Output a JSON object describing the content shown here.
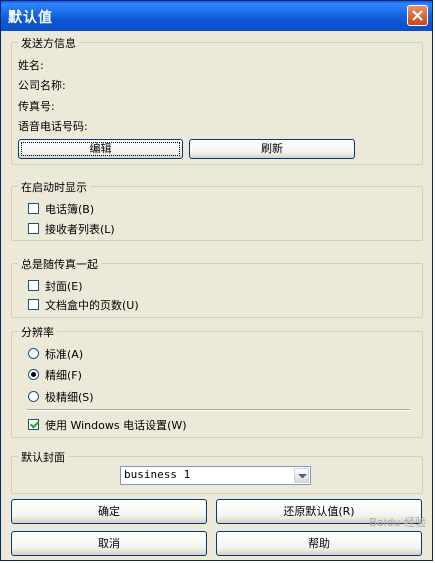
{
  "window": {
    "title": "默认值"
  },
  "sender": {
    "legend": "发送方信息",
    "name_label": "姓名:",
    "company_label": "公司名称:",
    "fax_label": "传真号:",
    "voice_label": "语音电话号码:",
    "edit_label": "编辑",
    "refresh_label": "刷新"
  },
  "startup": {
    "legend": "在启动时显示",
    "phonebook_label": "电话簿(B)",
    "phonebook_checked": false,
    "recipients_label": "接收者列表(L)",
    "recipients_checked": false
  },
  "always": {
    "legend": "总是随传真一起",
    "cover_label": "封面(E)",
    "cover_checked": false,
    "pages_label": "文档盒中的页数(U)",
    "pages_checked": false
  },
  "resolution": {
    "legend": "分辨率",
    "options": [
      {
        "label": "标准(A)",
        "selected": false
      },
      {
        "label": "精细(F)",
        "selected": true
      },
      {
        "label": "极精细(S)",
        "selected": false
      }
    ],
    "windows_label": "使用 Windows 电话设置(W)",
    "windows_checked": true
  },
  "cover_default": {
    "legend": "默认封面",
    "selected_value": "business 1"
  },
  "buttons": {
    "ok": "确定",
    "restore": "还原默认值(R)",
    "cancel": "取消",
    "help": "帮助"
  },
  "watermark": "Baidu 经验"
}
